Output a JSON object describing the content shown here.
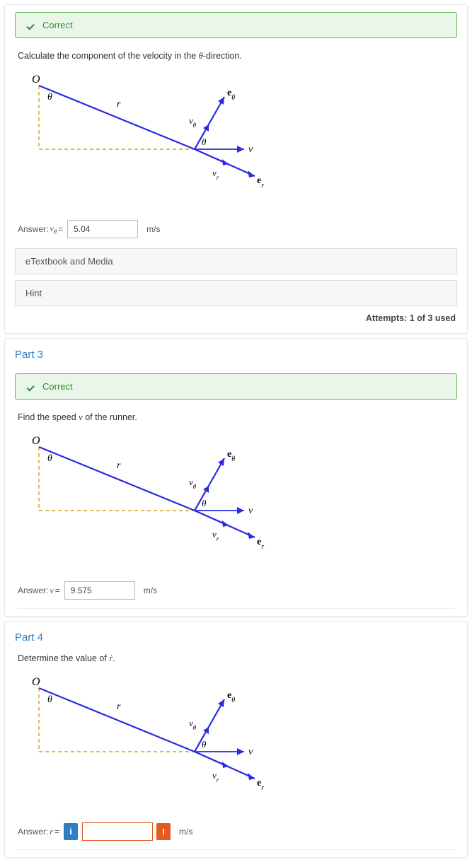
{
  "parts": [
    {
      "id": "2",
      "show_header": false,
      "correct": true,
      "correct_label": "Correct",
      "prompt_html": "Calculate the component of the velocity in the <span class='ital'>θ</span>-direction.",
      "answer_label_html": "Answer: <span class='ital'>v<sub>θ</sub></span> =",
      "answer_value": "5.04",
      "unit": "m/s",
      "info_badge": false,
      "error_badge": false,
      "etextbook_label": "eTextbook and Media",
      "hint_label": "Hint",
      "attempts_text": "Attempts: 1 of 3 used",
      "show_attempts": true,
      "show_subbuttons": true
    },
    {
      "id": "3",
      "show_header": true,
      "header": "Part 3",
      "correct": true,
      "correct_label": "Correct",
      "prompt_html": "Find the speed <span class='ital'>v</span> of the runner.",
      "answer_label_html": "Answer: <span class='ital'>v</span> =",
      "answer_value": "9.575",
      "unit": "m/s",
      "info_badge": false,
      "error_badge": false,
      "show_attempts": false,
      "show_subbuttons": false
    },
    {
      "id": "4",
      "show_header": true,
      "header": "Part 4",
      "correct": false,
      "prompt_html": "Determine the value of <span class='ital'>ṙ</span>.",
      "answer_label_html": "Answer: <span class='ital'>ṙ</span> =",
      "answer_value": "",
      "unit": "m/s",
      "info_badge": true,
      "error_badge": true,
      "show_attempts": false,
      "show_subbuttons": false
    }
  ]
}
